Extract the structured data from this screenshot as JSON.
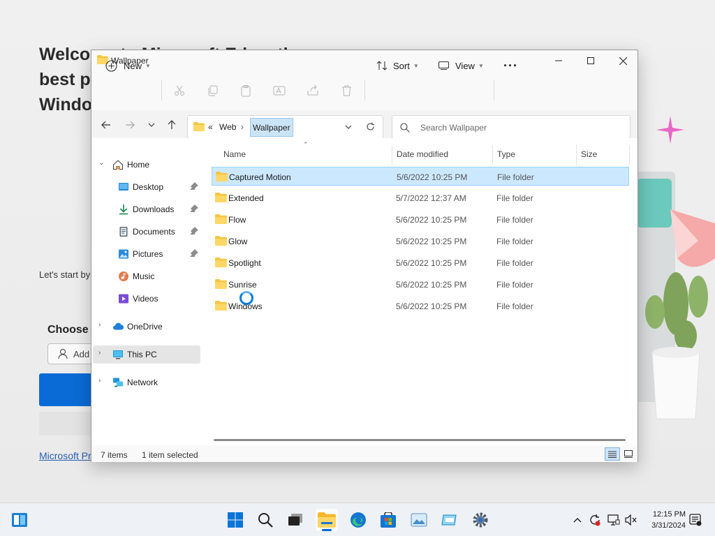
{
  "background": {
    "heading": "Welcome to Microsoft Edge, the best performing browser on Windows",
    "text": "Let's start by importing your passwords,",
    "choose_label": "Choose a",
    "add_label": "Add",
    "link": "Microsoft Pr"
  },
  "window": {
    "title": "Wallpaper",
    "controls": [
      "minimize",
      "maximize",
      "close"
    ]
  },
  "toolbar": {
    "new_label": "New",
    "sort_label": "Sort",
    "view_label": "View",
    "more_label": "···",
    "icons": [
      "cut-icon",
      "copy-icon",
      "paste-icon",
      "rename-icon",
      "share-icon",
      "delete-icon"
    ]
  },
  "address": {
    "overflow": "«",
    "crumb_parent": "Web",
    "crumb_current": "Wallpaper",
    "search_placeholder": "Search Wallpaper"
  },
  "sidebar": {
    "items": [
      {
        "label": "Home",
        "icon": "home-icon"
      },
      {
        "label": "Desktop",
        "icon": "desktop-icon",
        "pinned": true
      },
      {
        "label": "Downloads",
        "icon": "downloads-icon",
        "pinned": true
      },
      {
        "label": "Documents",
        "icon": "documents-icon",
        "pinned": true
      },
      {
        "label": "Pictures",
        "icon": "pictures-icon",
        "pinned": true
      },
      {
        "label": "Music",
        "icon": "music-icon"
      },
      {
        "label": "Videos",
        "icon": "videos-icon"
      },
      {
        "label": "OneDrive",
        "icon": "onedrive-icon"
      },
      {
        "label": "This PC",
        "icon": "this-pc-icon",
        "selected": true
      },
      {
        "label": "Network",
        "icon": "network-icon"
      }
    ]
  },
  "columns": {
    "name": "Name",
    "date": "Date modified",
    "type": "Type",
    "size": "Size"
  },
  "files": [
    {
      "name": "Captured Motion",
      "date": "5/6/2022 10:25 PM",
      "type": "File folder",
      "selected": true
    },
    {
      "name": "Extended",
      "date": "5/7/2022 12:37 AM",
      "type": "File folder"
    },
    {
      "name": "Flow",
      "date": "5/6/2022 10:25 PM",
      "type": "File folder"
    },
    {
      "name": "Glow",
      "date": "5/6/2022 10:25 PM",
      "type": "File folder"
    },
    {
      "name": "Spotlight",
      "date": "5/6/2022 10:25 PM",
      "type": "File folder"
    },
    {
      "name": "Sunrise",
      "date": "5/6/2022 10:25 PM",
      "type": "File folder"
    },
    {
      "name": "Windows",
      "date": "5/6/2022 10:25 PM",
      "type": "File folder"
    }
  ],
  "status": {
    "items_count": "7 items",
    "selected_count": "1 item selected"
  },
  "taskbar": {
    "time": "12:15 PM",
    "date": "3/31/2024"
  },
  "colors": {
    "accent": "#0a6bd6",
    "selection": "#cce8ff",
    "folder": "#f5c542"
  }
}
